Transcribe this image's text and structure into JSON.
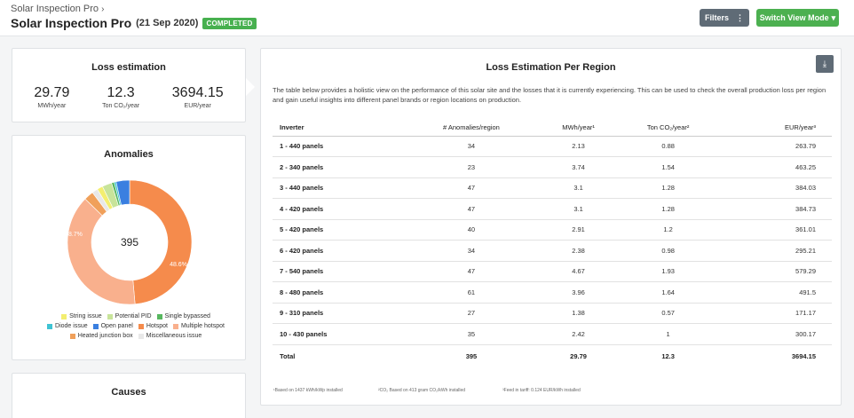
{
  "header": {
    "breadcrumb": "Solar Inspection Pro",
    "title": "Solar Inspection Pro",
    "date": "(21 Sep 2020)",
    "status": "COMPLETED",
    "filters_label": "Filters",
    "switch_label": "Switch View Mode"
  },
  "loss_estimation": {
    "title": "Loss estimation",
    "metrics": [
      {
        "value": "29.79",
        "unit": "MWh/year"
      },
      {
        "value": "12.3",
        "unit": "Ton CO₂/year"
      },
      {
        "value": "3694.15",
        "unit": "EUR/year"
      }
    ]
  },
  "anomalies": {
    "title": "Anomalies",
    "total": "395",
    "label_large": "48.6%",
    "label_second": "38.7%",
    "slices": [
      {
        "name": "Hotspot",
        "pct": 48.6,
        "color": "#f58b4c"
      },
      {
        "name": "Multiple hotspot",
        "pct": 38.7,
        "color": "#f9b08d"
      },
      {
        "name": "Heated junction box",
        "pct": 2.5,
        "color": "#f0a05a"
      },
      {
        "name": "Miscellaneous issue",
        "pct": 1.5,
        "color": "#e8e8e8"
      },
      {
        "name": "String issue",
        "pct": 1.5,
        "color": "#f3ee70"
      },
      {
        "name": "Potential PID",
        "pct": 2.5,
        "color": "#c8e49a"
      },
      {
        "name": "Single bypassed",
        "pct": 0.7,
        "color": "#57b75f"
      },
      {
        "name": "Diode issue",
        "pct": 0.5,
        "color": "#3fc3d3"
      },
      {
        "name": "Open panel",
        "pct": 3.5,
        "color": "#3a7fe0"
      }
    ],
    "legend_rows": [
      [
        {
          "name": "String issue",
          "color": "#f3ee70"
        },
        {
          "name": "Potential PID",
          "color": "#c8e49a"
        },
        {
          "name": "Single bypassed",
          "color": "#57b75f"
        }
      ],
      [
        {
          "name": "Diode issue",
          "color": "#3fc3d3"
        },
        {
          "name": "Open panel",
          "color": "#3a7fe0"
        },
        {
          "name": "Hotspot",
          "color": "#f58b4c"
        },
        {
          "name": "Multiple hotspot",
          "color": "#f9b08d"
        }
      ],
      [
        {
          "name": "Heated junction box",
          "color": "#f0a05a"
        },
        {
          "name": "Miscellaneous issue",
          "color": "#e8e8e8"
        }
      ]
    ]
  },
  "causes": {
    "title": "Causes"
  },
  "region": {
    "title": "Loss Estimation Per Region",
    "description": "The table below provides a holistic view on the performance of this solar site and the losses that it is currently experiencing. This can be used to check the overall production loss per region and gain useful insights into different panel brands or region locations on production.",
    "columns": [
      "Inverter",
      "# Anomalies/region",
      "MWh/year¹",
      "Ton CO₂/year²",
      "EUR/year³"
    ],
    "rows": [
      [
        "1 - 440 panels",
        "34",
        "2.13",
        "0.88",
        "263.79"
      ],
      [
        "2 - 340 panels",
        "23",
        "3.74",
        "1.54",
        "463.25"
      ],
      [
        "3 - 440 panels",
        "47",
        "3.1",
        "1.28",
        "384.03"
      ],
      [
        "4 - 420 panels",
        "47",
        "3.1",
        "1.28",
        "384.73"
      ],
      [
        "5 - 420 panels",
        "40",
        "2.91",
        "1.2",
        "361.01"
      ],
      [
        "6 - 420 panels",
        "34",
        "2.38",
        "0.98",
        "295.21"
      ],
      [
        "7 - 540 panels",
        "47",
        "4.67",
        "1.93",
        "579.29"
      ],
      [
        "8 - 480 panels",
        "61",
        "3.96",
        "1.64",
        "491.5"
      ],
      [
        "9 - 310 panels",
        "27",
        "1.38",
        "0.57",
        "171.17"
      ],
      [
        "10 - 430 panels",
        "35",
        "2.42",
        "1",
        "300.17"
      ]
    ],
    "total": [
      "Total",
      "395",
      "29.79",
      "12.3",
      "3694.15"
    ],
    "footnotes": [
      "¹Based on 1437 kWh/kWp installed",
      "²CO₂ Based on 413 gram CO₂/kWh installed",
      "³Feed in tariff: 0.124 EUR/kWh installed"
    ]
  }
}
